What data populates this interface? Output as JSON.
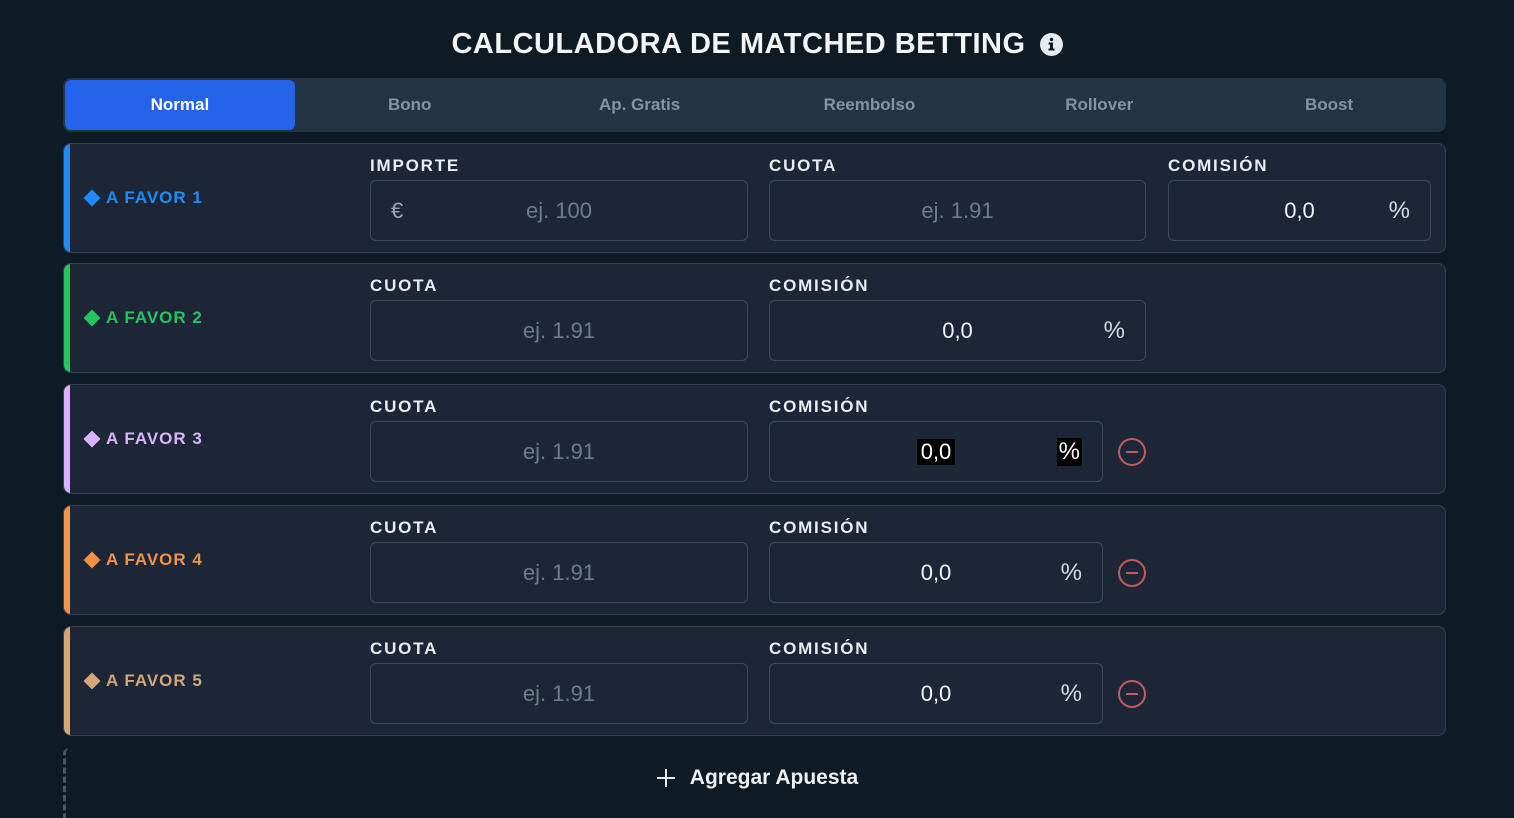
{
  "header": {
    "title": "CALCULADORA DE MATCHED BETTING",
    "info_icon": "info-icon"
  },
  "tabs": [
    {
      "label": "Normal",
      "active": true
    },
    {
      "label": "Bono",
      "active": false
    },
    {
      "label": "Ap. Gratis",
      "active": false
    },
    {
      "label": "Reembolso",
      "active": false
    },
    {
      "label": "Rollover",
      "active": false
    },
    {
      "label": "Boost",
      "active": false
    }
  ],
  "bets": [
    {
      "label": "A FAVOR 1",
      "color": "#1d8cf8",
      "importe": {
        "label": "IMPORTE",
        "prefix": "€",
        "placeholder": "ej. 100"
      },
      "cuota": {
        "label": "CUOTA",
        "placeholder": "ej. 1.91"
      },
      "comision": {
        "label": "COMISIÓN",
        "value": "0,0",
        "suffix": "%"
      }
    },
    {
      "label": "A FAVOR 2",
      "color": "#22c55e",
      "cuota": {
        "label": "CUOTA",
        "placeholder": "ej. 1.91"
      },
      "comision": {
        "label": "COMISIÓN",
        "value": "0,0",
        "suffix": "%"
      }
    },
    {
      "label": "A FAVOR 3",
      "color": "#d8b4fe",
      "cuota": {
        "label": "CUOTA",
        "placeholder": "ej. 1.91"
      },
      "comision": {
        "label": "COMISIÓN",
        "value": "0,0",
        "suffix": "%"
      }
    },
    {
      "label": "A FAVOR 4",
      "color": "#f59245",
      "cuota": {
        "label": "CUOTA",
        "placeholder": "ej. 1.91"
      },
      "comision": {
        "label": "COMISIÓN",
        "value": "0,0",
        "suffix": "%"
      }
    },
    {
      "label": "A FAVOR 5",
      "color": "#d2a679",
      "cuota": {
        "label": "CUOTA",
        "placeholder": "ej. 1.91"
      },
      "comision": {
        "label": "COMISIÓN",
        "value": "0,0",
        "suffix": "%"
      }
    }
  ],
  "add_bet": {
    "label": "Agregar Apuesta",
    "icon": "plus-icon"
  }
}
